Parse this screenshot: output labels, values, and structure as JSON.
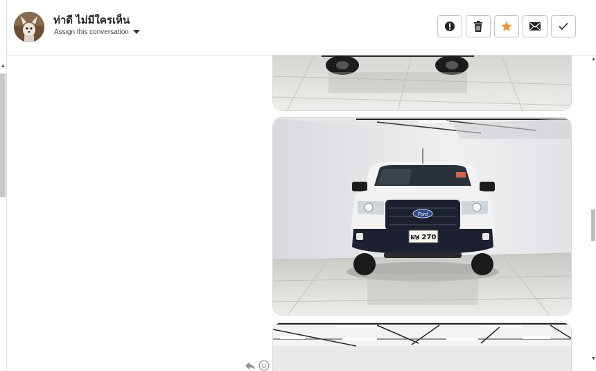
{
  "contact": {
    "name": "ท่าดี ไม่มีใครเห็น",
    "assign_label": "Assign this conversation"
  },
  "toolbar": {
    "buttons": [
      {
        "icon": "alert-icon",
        "color": "#222222"
      },
      {
        "icon": "trash-icon",
        "color": "#222222"
      },
      {
        "icon": "star-icon",
        "color": "#f0962e"
      },
      {
        "icon": "envelope-icon",
        "color": "#222222"
      },
      {
        "icon": "check-icon",
        "color": "#222222"
      }
    ]
  },
  "message": {
    "photo_plate_text": "ผษ 270",
    "photo_brand_text": "Ford"
  }
}
